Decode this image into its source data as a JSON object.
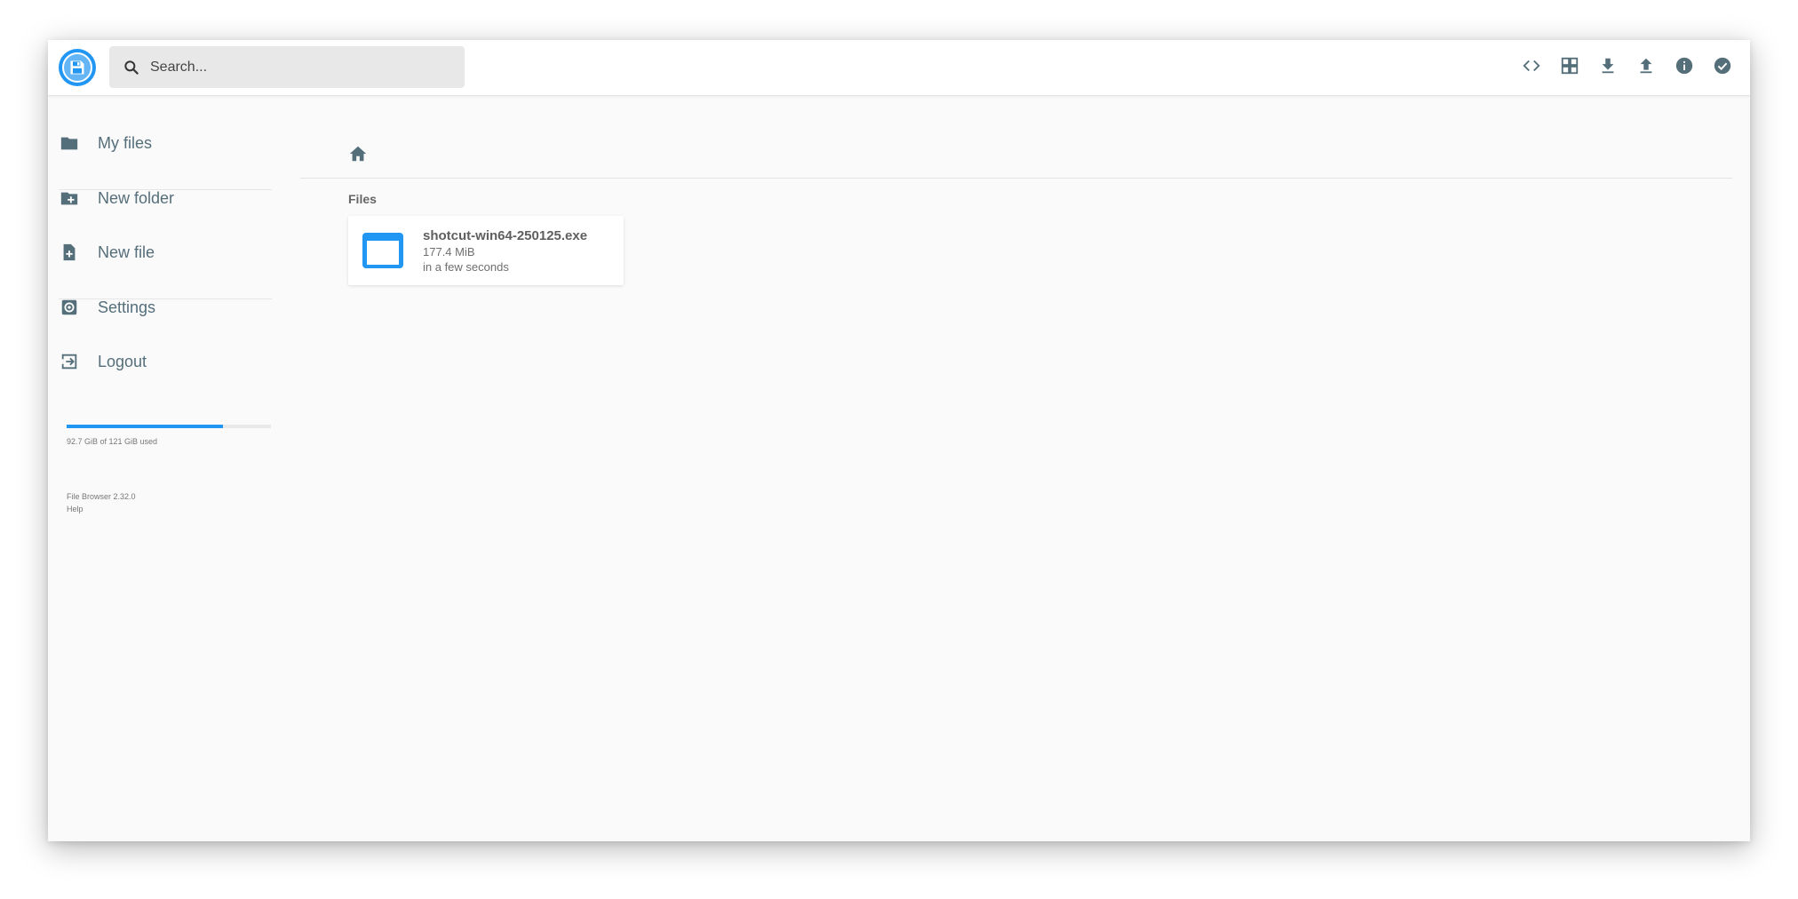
{
  "app": {
    "name": "File Browser",
    "logo_icon": "floppy-disk-icon",
    "accent_color": "#2196f3",
    "icon_color": "#546e7a"
  },
  "search": {
    "placeholder": "Search...",
    "value": ""
  },
  "toolbar": {
    "buttons": [
      {
        "icon": "code-icon"
      },
      {
        "icon": "grid-view-icon"
      },
      {
        "icon": "download-icon"
      },
      {
        "icon": "upload-icon"
      },
      {
        "icon": "info-icon"
      },
      {
        "icon": "check-circle-icon"
      }
    ]
  },
  "sidebar": {
    "items": [
      {
        "label": "My files",
        "icon": "folder-icon"
      },
      {
        "label": "New folder",
        "icon": "create-new-folder-icon"
      },
      {
        "label": "New file",
        "icon": "note-add-icon"
      },
      {
        "label": "Settings",
        "icon": "settings-icon"
      },
      {
        "label": "Logout",
        "icon": "logout-icon"
      }
    ],
    "usage": {
      "text": "92.7 GiB of 121 GiB used",
      "fraction": 0.766
    },
    "credits": {
      "version": "File Browser 2.32.0",
      "help": "Help"
    }
  },
  "main": {
    "breadcrumb_icon": "home-icon",
    "section_title": "Files",
    "files": [
      {
        "name": "shotcut-win64-250125.exe",
        "size": "177.4 MiB",
        "modified": "in a few seconds",
        "icon": "application-icon"
      }
    ]
  }
}
